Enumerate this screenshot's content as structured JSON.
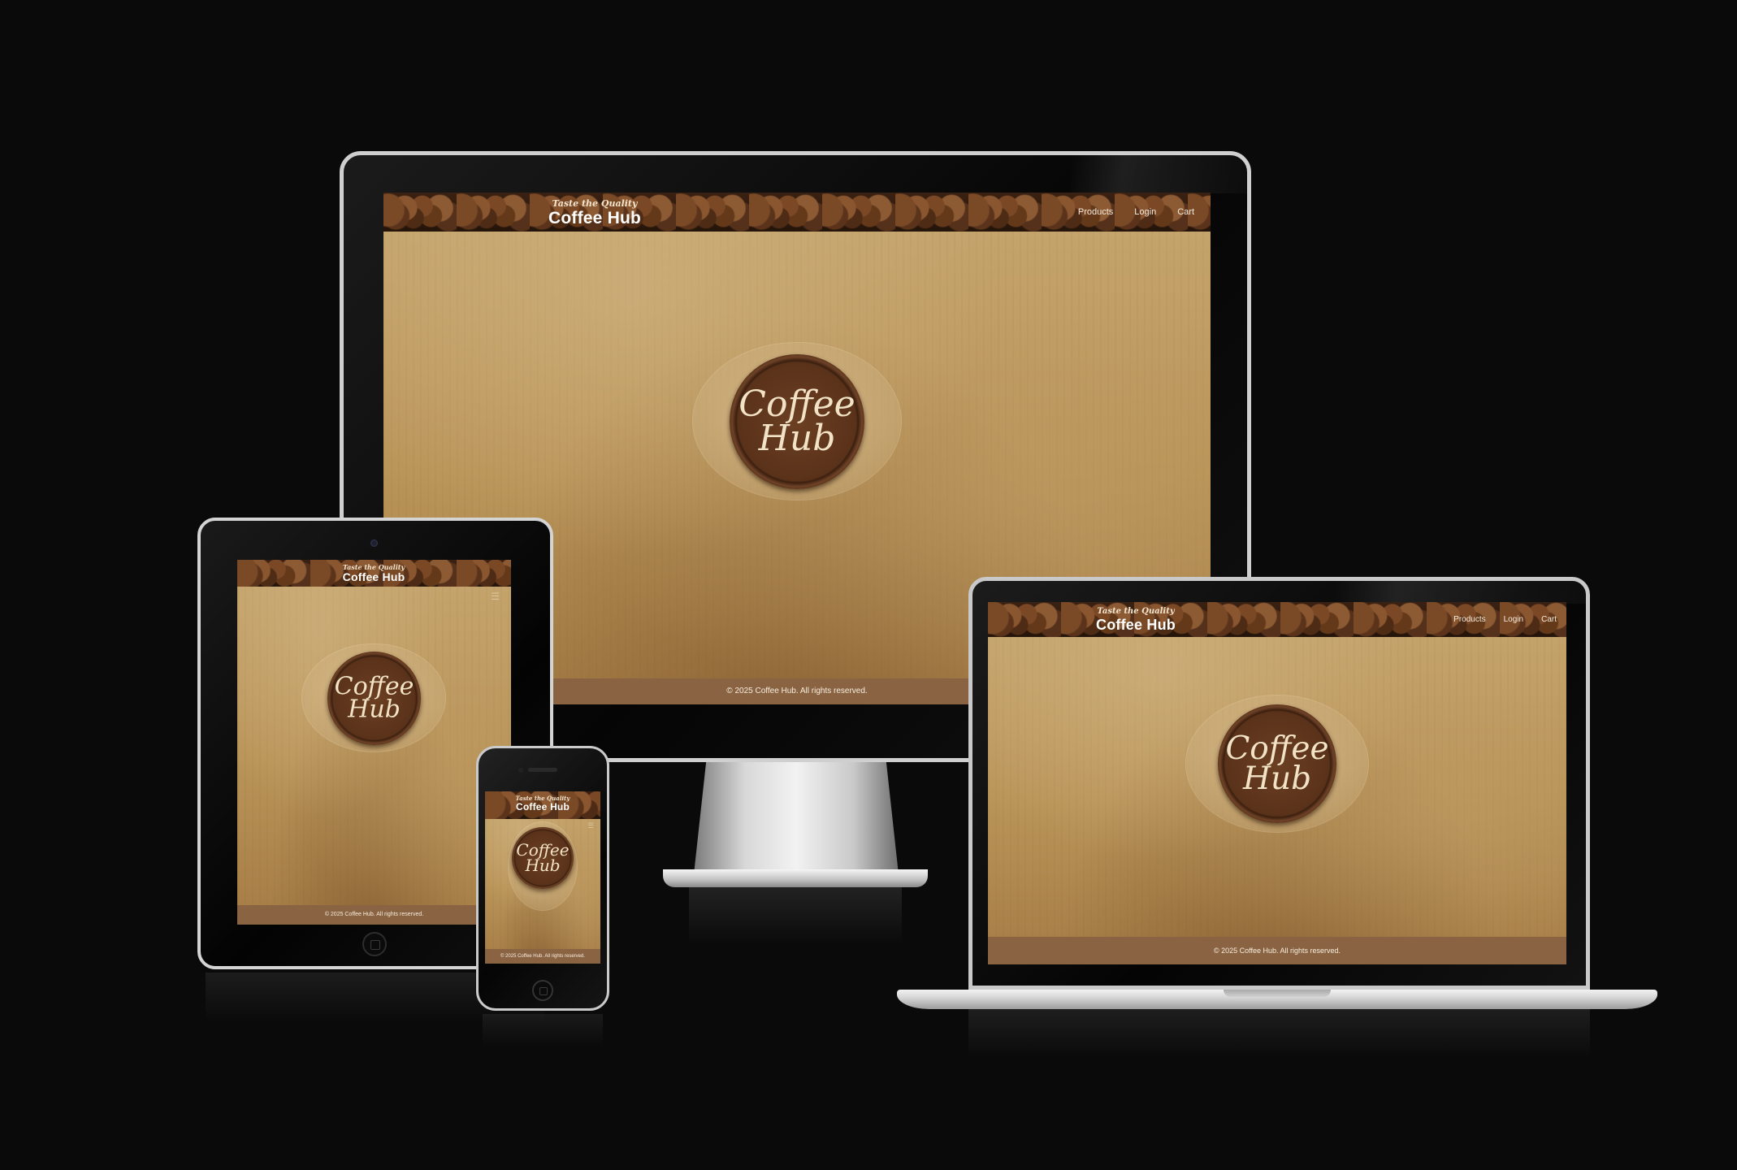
{
  "site": {
    "tagline": "Taste the Quality",
    "brand": "Coffee Hub",
    "nav": [
      "Products",
      "Login",
      "Cart"
    ],
    "logo_line1": "Coffee",
    "logo_line2": "Hub",
    "footer": "© 2025 Coffee Hub. All rights reserved.",
    "menu_icon": "hamburger-menu-icon"
  },
  "devices": [
    "iMac",
    "iPad",
    "iPhone",
    "MacBook"
  ],
  "colors": {
    "background": "#0b0a0a",
    "paper": "#b99458",
    "footer": "#8a6442",
    "logo_disc": "#5a321a",
    "logo_text": "#f2e3c6"
  }
}
